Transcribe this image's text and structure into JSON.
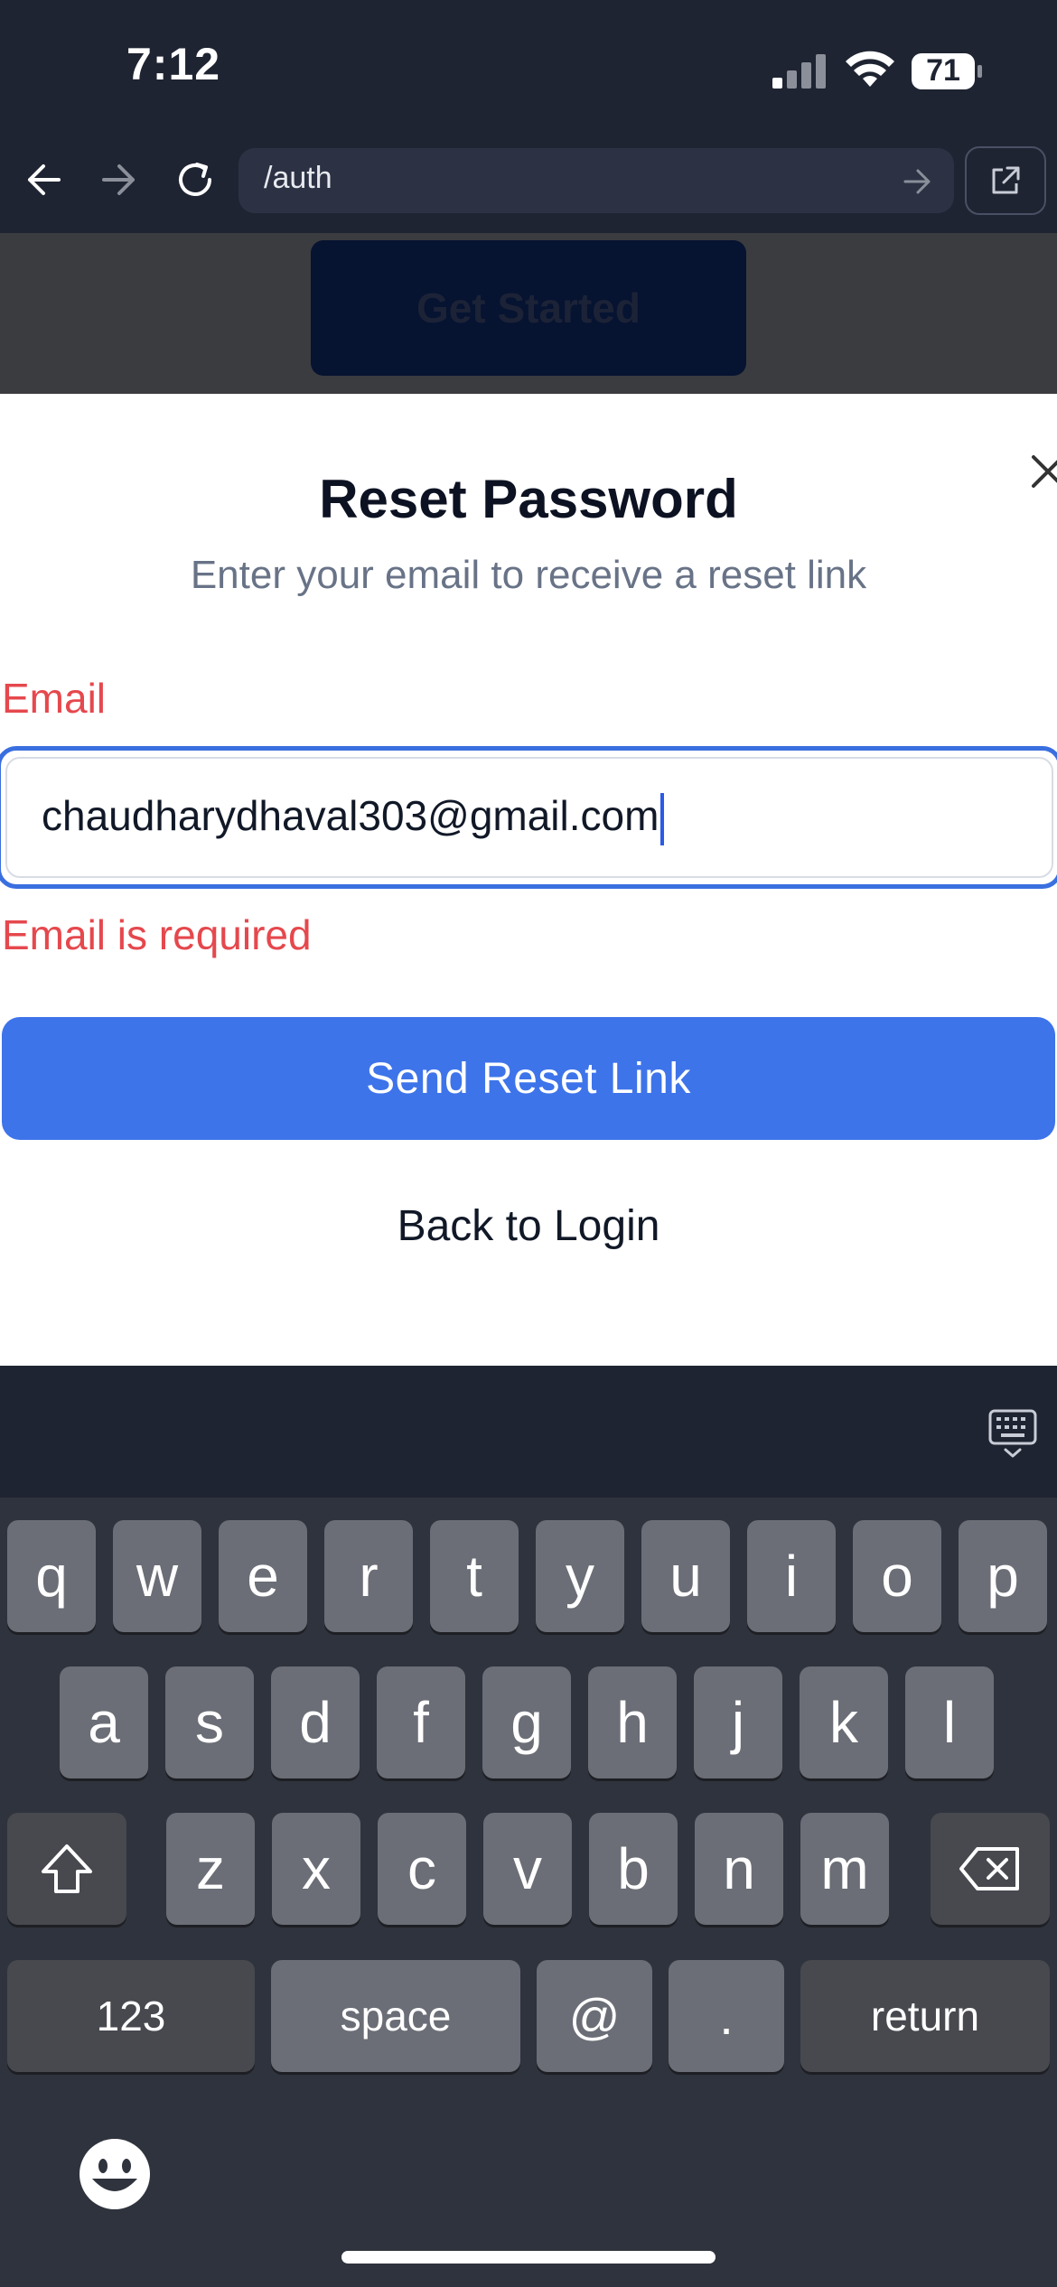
{
  "status_bar": {
    "time": "7:12",
    "battery": "71"
  },
  "browser": {
    "url": "/auth"
  },
  "background_page": {
    "button_label": "Get Started"
  },
  "modal": {
    "title": "Reset Password",
    "subtitle": "Enter your email to receive a reset link",
    "email_label": "Email",
    "email_value": "chaudharydhaval303@gmail.com",
    "error": "Email is required",
    "send_button": "Send Reset Link",
    "back_link": "Back to Login"
  },
  "keyboard": {
    "row1": [
      "q",
      "w",
      "e",
      "r",
      "t",
      "y",
      "u",
      "i",
      "o",
      "p"
    ],
    "row2": [
      "a",
      "s",
      "d",
      "f",
      "g",
      "h",
      "j",
      "k",
      "l"
    ],
    "row3": [
      "z",
      "x",
      "c",
      "v",
      "b",
      "n",
      "m"
    ],
    "numbers_key": "123",
    "space_key": "space",
    "at_key": "@",
    "dot_key": ".",
    "return_key": "return"
  },
  "colors": {
    "accent": "#3e74ea",
    "error": "#e5484d",
    "chrome_bg": "#1f2432"
  }
}
